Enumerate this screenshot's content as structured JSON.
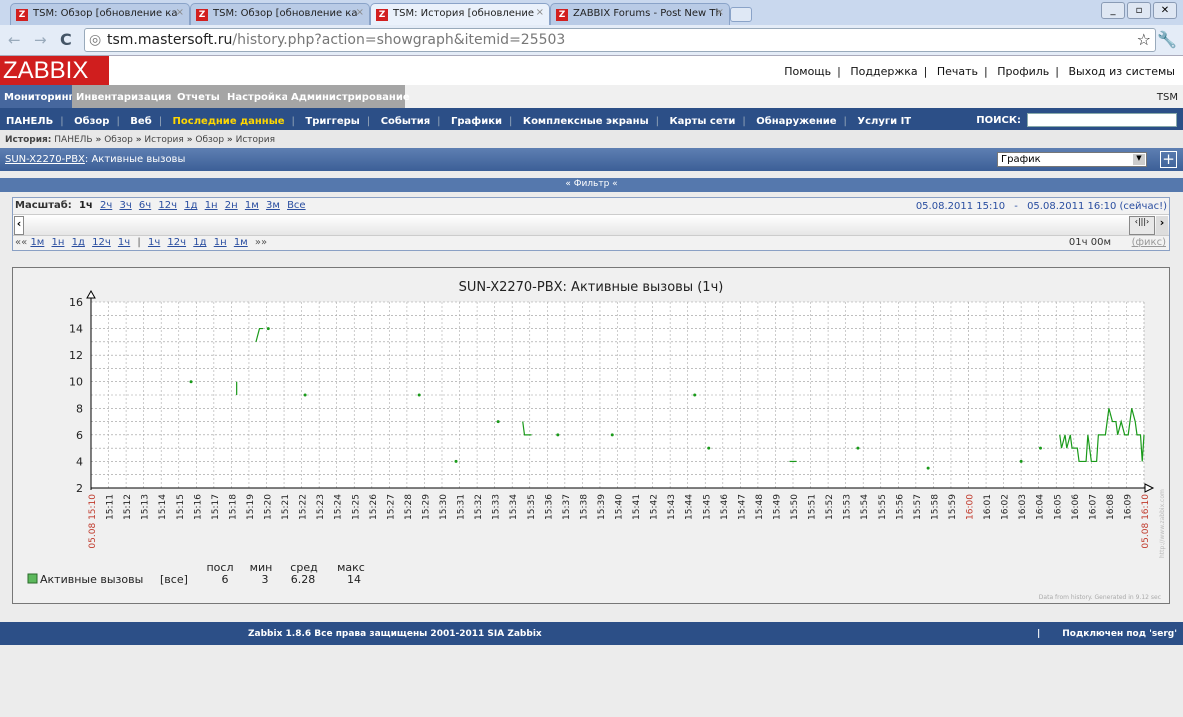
{
  "browser": {
    "tabs": [
      {
        "title": "TSM: Обзор [обновление ка",
        "active": false
      },
      {
        "title": "TSM: Обзор [обновление ка",
        "active": false
      },
      {
        "title": "TSM: История [обновление",
        "active": true
      },
      {
        "title": "ZABBIX Forums - Post New Th",
        "active": false
      }
    ],
    "url_host": "tsm.mastersoft.ru",
    "url_path": "/history.php?action=showgraph&itemid=25503"
  },
  "header": {
    "logo": "ZABBIX",
    "links": [
      "Помощь",
      "Поддержка",
      "Печать",
      "Профиль",
      "Выход из системы"
    ]
  },
  "main_menu": {
    "items": [
      "Мониторинг",
      "Инвентаризация",
      "Отчеты",
      "Настройка",
      "Администрирование"
    ],
    "active": 0,
    "node": "TSM"
  },
  "sub_menu": {
    "items": [
      "ПАНЕЛЬ",
      "Обзор",
      "Веб",
      "Последние данные",
      "Триггеры",
      "События",
      "Графики",
      "Комплексные экраны",
      "Карты сети",
      "Обнаружение",
      "Услуги IT"
    ],
    "active": 3,
    "search_label": "ПОИСК:",
    "search_value": ""
  },
  "breadcrumb": {
    "label": "История:",
    "items": [
      "ПАНЕЛЬ",
      "Обзор",
      "История",
      "Обзор",
      "История"
    ],
    "sep": "»"
  },
  "titlebar": {
    "host": "SUN-X2270-PBX",
    "item": ": Активные вызовы",
    "select": "График",
    "plus": "+"
  },
  "filter": {
    "label": "« Фильтр «"
  },
  "scale": {
    "label": "Масштаб:",
    "options": [
      "1ч",
      "2ч",
      "3ч",
      "6ч",
      "12ч",
      "1д",
      "1н",
      "2н",
      "1м",
      "3м",
      "Все"
    ],
    "active": 0,
    "range_from": "05.08.2011 15:10",
    "range_sep": "-",
    "range_to": "05.08.2011 16:10 (сейчас!)",
    "back_label": "««",
    "back": [
      "1м",
      "1н",
      "1д",
      "12ч",
      "1ч"
    ],
    "fwd": [
      "1ч",
      "12ч",
      "1д",
      "1н",
      "1м"
    ],
    "fwd_label": "»»",
    "duration": "01ч 00м",
    "fixed": "(фикс)"
  },
  "chart_data": {
    "type": "line",
    "title": "SUN-X2270-PBX: Активные вызовы  (1ч)",
    "ylim": [
      2,
      16
    ],
    "yticks": [
      "2",
      "4",
      "6",
      "8",
      "10",
      "12",
      "14",
      "16"
    ],
    "xlim_minutes": [
      0,
      60
    ],
    "xticks": [
      "05.08 15:10",
      "15:11",
      "15:12",
      "15:13",
      "15:14",
      "15:15",
      "15:16",
      "15:17",
      "15:18",
      "15:19",
      "15:20",
      "15:21",
      "15:22",
      "15:23",
      "15:24",
      "15:25",
      "15:26",
      "15:27",
      "15:28",
      "15:29",
      "15:30",
      "15:31",
      "15:32",
      "15:33",
      "15:34",
      "15:35",
      "15:36",
      "15:37",
      "15:38",
      "15:39",
      "15:40",
      "15:41",
      "15:42",
      "15:43",
      "15:44",
      "15:45",
      "15:46",
      "15:47",
      "15:48",
      "15:49",
      "15:50",
      "15:51",
      "15:52",
      "15:53",
      "15:54",
      "15:55",
      "15:56",
      "15:57",
      "15:58",
      "15:59",
      "16:00",
      "16:01",
      "16:02",
      "16:03",
      "16:04",
      "16:05",
      "16:06",
      "16:07",
      "16:08",
      "16:09",
      "05.08 16:10"
    ],
    "highlight_ticks": [
      "05.08 15:10",
      "16:00",
      "05.08 16:10"
    ],
    "series": [
      {
        "name": "Активные вызовы",
        "color": "#1a9a1a",
        "segments": [
          [
            [
              5.7,
              10
            ]
          ],
          [
            [
              8.3,
              10
            ],
            [
              8.3,
              9
            ]
          ],
          [
            [
              9.4,
              13
            ],
            [
              9.6,
              14
            ],
            [
              9.8,
              14
            ]
          ],
          [
            [
              10.1,
              14
            ]
          ],
          [
            [
              12.2,
              9
            ]
          ],
          [
            [
              18.7,
              9
            ]
          ],
          [
            [
              20.8,
              4
            ]
          ],
          [
            [
              23.2,
              7
            ]
          ],
          [
            [
              24.6,
              7
            ],
            [
              24.7,
              6
            ],
            [
              25.1,
              6
            ]
          ],
          [
            [
              26.6,
              6
            ]
          ],
          [
            [
              29.7,
              6
            ]
          ],
          [
            [
              34.4,
              9
            ]
          ],
          [
            [
              35.2,
              5
            ]
          ],
          [
            [
              39.8,
              4
            ],
            [
              40.2,
              4
            ]
          ],
          [
            [
              43.7,
              5
            ]
          ],
          [
            [
              47.7,
              3.5
            ]
          ],
          [
            [
              53.0,
              4
            ]
          ],
          [
            [
              54.1,
              5
            ]
          ],
          [
            [
              55.2,
              6
            ],
            [
              55.3,
              5
            ],
            [
              55.5,
              6
            ],
            [
              55.6,
              5
            ],
            [
              55.8,
              6
            ],
            [
              55.9,
              5
            ],
            [
              56.2,
              5
            ],
            [
              56.3,
              4
            ],
            [
              56.7,
              4
            ],
            [
              56.8,
              6
            ],
            [
              57.0,
              4
            ],
            [
              57.3,
              4
            ],
            [
              57.4,
              6
            ],
            [
              57.8,
              6
            ],
            [
              58.0,
              8
            ],
            [
              58.2,
              7
            ],
            [
              58.4,
              7
            ],
            [
              58.5,
              6
            ],
            [
              58.7,
              7
            ],
            [
              58.9,
              6
            ],
            [
              59.1,
              6
            ],
            [
              59.3,
              8
            ],
            [
              59.5,
              7
            ],
            [
              59.6,
              6
            ],
            [
              59.8,
              6
            ],
            [
              59.9,
              4
            ],
            [
              60.0,
              6
            ]
          ]
        ]
      }
    ],
    "legend": {
      "name": "Активные вызовы",
      "scope": "[все]",
      "headers": [
        "посл",
        "мин",
        "сред",
        "макс"
      ],
      "values": [
        "6",
        "3",
        "6.28",
        "14"
      ]
    },
    "watermark": "http://www.zabbix.com",
    "footer_note": "Data from history. Generated in 9.12 sec"
  },
  "footer": {
    "copyright": "Zabbix 1.8.6 Все права защищены 2001-2011 SIA Zabbix",
    "connected": "Подключен под 'serg'"
  }
}
